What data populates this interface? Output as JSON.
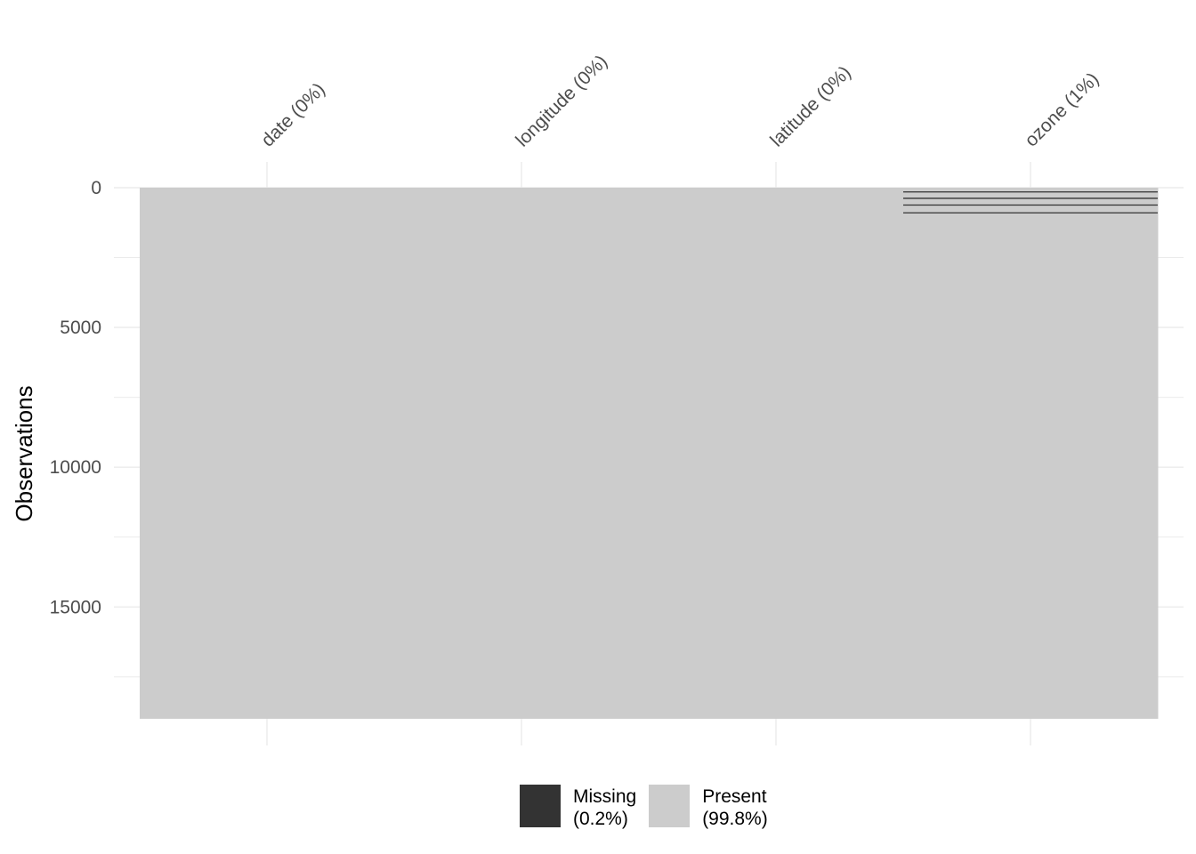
{
  "chart_data": {
    "type": "heatmap",
    "title": "",
    "xlabel": "",
    "ylabel": "Observations",
    "columns": [
      "date (0%)",
      "longitude (0%)",
      "latitude (0%)",
      "ozone (1%)"
    ],
    "n_observations": 19000,
    "ylim": [
      0,
      19000
    ],
    "y_ticks": [
      0,
      5000,
      10000,
      15000
    ],
    "grid": true,
    "missing_rows": {
      "date (0%)": [],
      "longitude (0%)": [],
      "latitude (0%)": [],
      "ozone (1%)": [
        150,
        380,
        620,
        900
      ]
    },
    "legend_position": "bottom",
    "legend": [
      {
        "key": "missing",
        "label": "Missing",
        "pct": "(0.2%)",
        "color": "#333333"
      },
      {
        "key": "present",
        "label": "Present",
        "pct": "(99.8%)",
        "color": "#cccccc"
      }
    ]
  }
}
